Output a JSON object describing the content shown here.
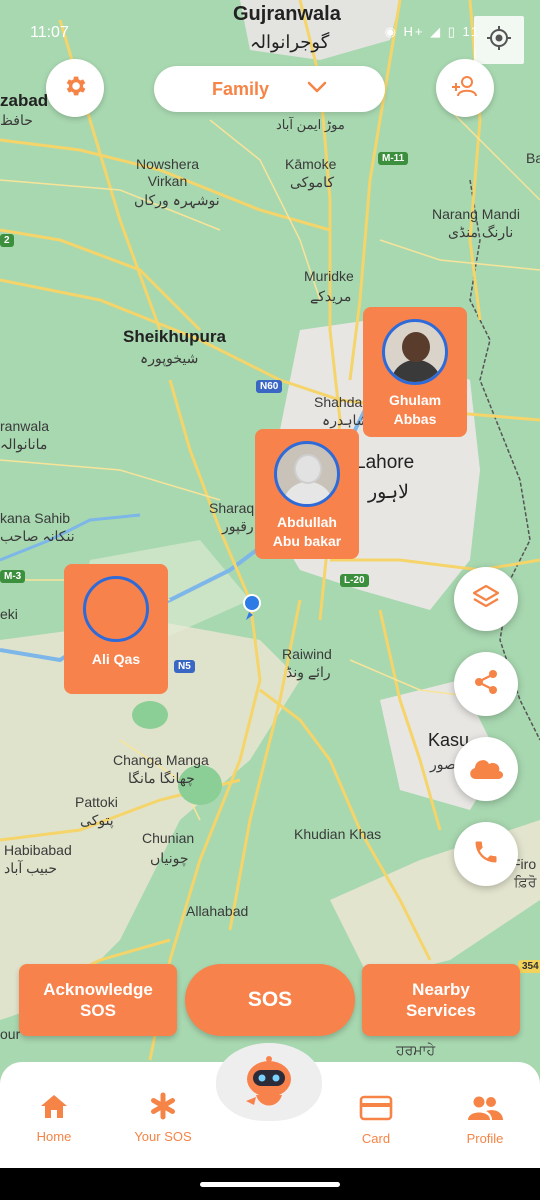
{
  "status_bar": {
    "time": "11:07",
    "icons": "◉ H+ ◢ ▯ 11"
  },
  "header": {
    "family_select": {
      "value": "Family"
    }
  },
  "map_labels": {
    "gujranwala": "Gujranwala",
    "gujranwala_ur": "گوجرانوالہ",
    "hafizabad": "zabad",
    "hafizabad_ur": "حافظ",
    "moza_aimen": "موڑ ایمن آباد",
    "nowshera": "Nowshera\nVirkan",
    "nowshera_ur": "نوشہرہ ورکاں",
    "kamoke": "Kāmoke",
    "kamoke_ur": "کاموکی",
    "narang": "Narang Mandi",
    "narang_ur": "نارنگ منڈی",
    "muridke": "Muridke",
    "muridke_ur": "مریدکے",
    "sheikhupura": "Sheikhupura",
    "sheikhupura_ur": "شیخوپورہ",
    "shahdara": "Shahdar",
    "shahdara_ur": "شاہدرہ",
    "lahore": "Lahore",
    "lahore_ur": "لاہور",
    "sharaqpur": "Sharaq",
    "sharaqpur_ur": "رقپور",
    "wala": "ranwala",
    "wala_ur": "مانانوالہ",
    "sahib": "kana Sahib",
    "sahib_ur": "ننکانہ صاحب",
    "eki": "eki",
    "raiwind": "Raiwind",
    "raiwind_ur": "رائے ونڈ",
    "kasur": "Kasu",
    "kasur_ur": "قصور",
    "changa": "Changa Manga",
    "changa_ur": "چھانگا مانگا",
    "pattoki": "Pattoki",
    "pattoki_ur": "پتوکی",
    "chunian": "Chunian",
    "chunian_ur": "چونیاں",
    "habibabad": "Habibabad",
    "habibabad_ur": "حبیب آباد",
    "khudian": "Khudian Khas",
    "allahabad": "Allahabad",
    "firoz": "Firo",
    "firoz_pa": "ਫ਼ਿਰੋ",
    "harmahe": "ਹਰਮਾਹੇ",
    "ba": "Ba",
    "our": "our"
  },
  "road_badges": {
    "m11": "M-11",
    "n60": "N60",
    "l20": "L-20",
    "n5": "N5",
    "m3": "M-3",
    "r2": "2",
    "r354": "354"
  },
  "members": [
    {
      "name": "Ghulam\nAbbas"
    },
    {
      "name": "Abdullah\nAbu bakar"
    },
    {
      "name": "Ali Qas"
    }
  ],
  "actions": {
    "acknowledge": "Acknowledge\nSOS",
    "sos": "SOS",
    "nearby": "Nearby\nServices"
  },
  "nav": {
    "home": "Home",
    "your_sos": "Your SOS",
    "card": "Card",
    "profile": "Profile"
  },
  "colors": {
    "accent": "#f8824b",
    "map_green": "#a8d8b0",
    "marker_blue": "#2f6bd8"
  }
}
